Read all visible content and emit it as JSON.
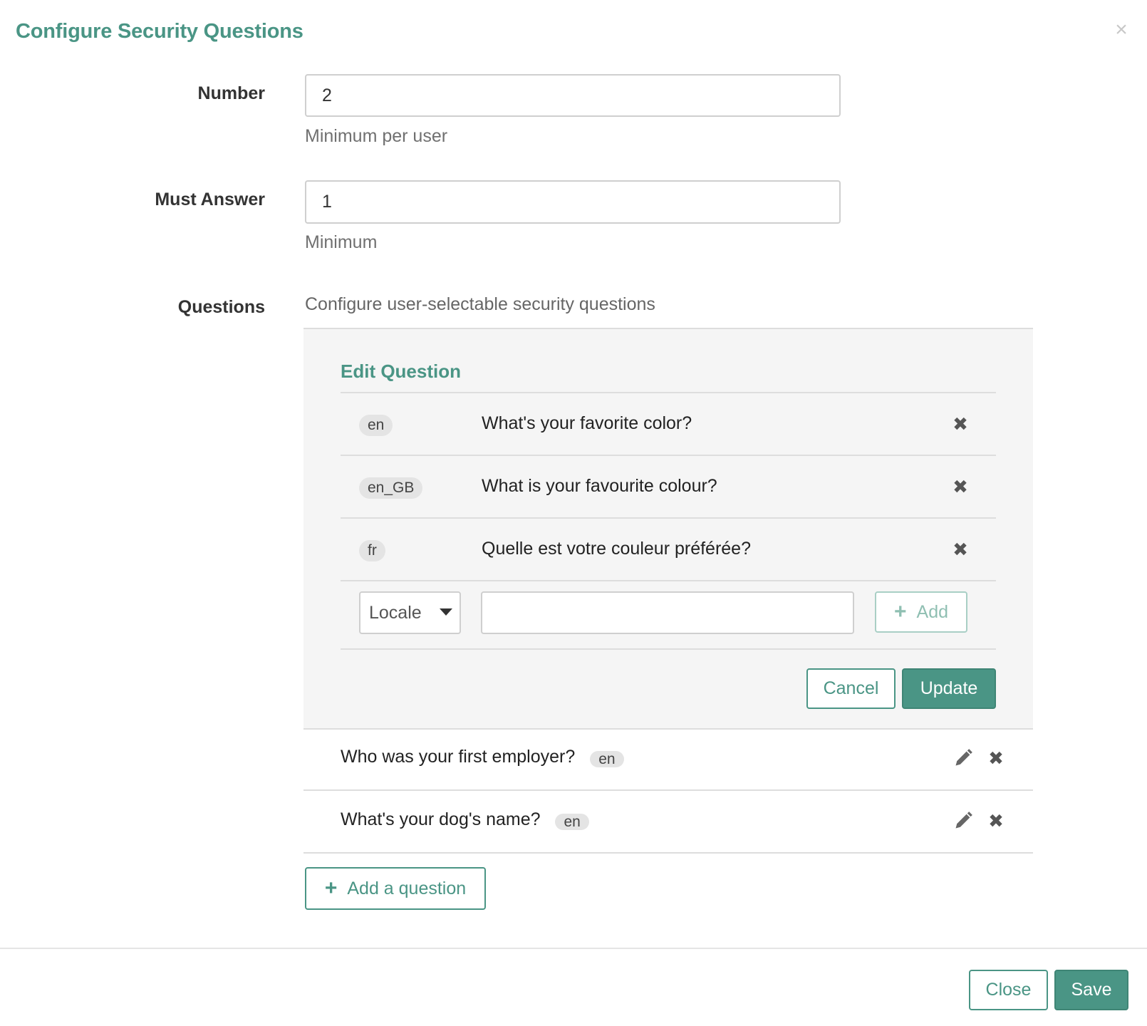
{
  "modal": {
    "title": "Configure Security Questions",
    "close_icon": "×"
  },
  "number": {
    "label": "Number",
    "value": "2",
    "help": "Minimum per user"
  },
  "must_answer": {
    "label": "Must Answer",
    "value": "1",
    "help": "Minimum"
  },
  "questions": {
    "label": "Questions",
    "description": "Configure user-selectable security questions"
  },
  "edit_panel": {
    "title": "Edit Question",
    "translations": [
      {
        "locale": "en",
        "text": "What's your favorite color?"
      },
      {
        "locale": "en_GB",
        "text": "What is your favourite colour?"
      },
      {
        "locale": "fr",
        "text": "Quelle est votre couleur préférée?"
      }
    ],
    "locale_select": "Locale",
    "question_input_value": "",
    "add_label": "Add",
    "cancel_label": "Cancel",
    "update_label": "Update"
  },
  "question_list": [
    {
      "text": "Who was your first employer?",
      "locale": "en"
    },
    {
      "text": "What's your dog's name?",
      "locale": "en"
    }
  ],
  "add_question_label": "Add a question",
  "footer": {
    "close_label": "Close",
    "save_label": "Save"
  },
  "icons": {
    "remove": "✖",
    "add": "+",
    "edit": "pencil-icon",
    "caret": "caret-down-icon"
  },
  "colors": {
    "accent": "#4a9585",
    "panel_bg": "#f5f5f5"
  }
}
